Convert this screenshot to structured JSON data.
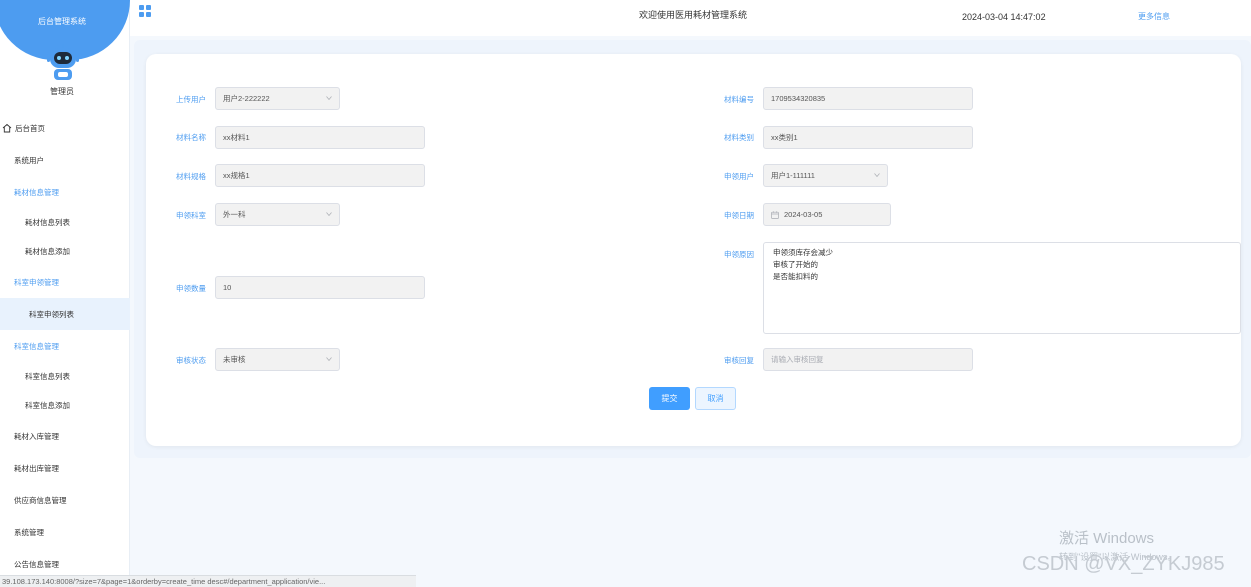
{
  "app": {
    "title": "后台管理系统",
    "role": "管理员"
  },
  "header": {
    "welcome": "欢迎使用医用耗材管理系统",
    "datetime": "2024-03-04 14:47:02",
    "more": "更多信息"
  },
  "menu": [
    {
      "label": "后台首页",
      "kind": "first"
    },
    {
      "label": "系统用户",
      "kind": "top"
    },
    {
      "label": "耗材信息管理",
      "kind": "group"
    },
    {
      "label": "耗材信息列表",
      "kind": "sub"
    },
    {
      "label": "耗材信息添加",
      "kind": "sub"
    },
    {
      "label": "科室申领管理",
      "kind": "group"
    },
    {
      "label": "科室申领列表",
      "kind": "active"
    },
    {
      "label": "科室信息管理",
      "kind": "group"
    },
    {
      "label": "科室信息列表",
      "kind": "sub"
    },
    {
      "label": "科室信息添加",
      "kind": "sub"
    },
    {
      "label": "耗材入库管理",
      "kind": "top"
    },
    {
      "label": "耗材出库管理",
      "kind": "top"
    },
    {
      "label": "供应商信息管理",
      "kind": "top"
    },
    {
      "label": "系统管理",
      "kind": "top"
    },
    {
      "label": "公告信息管理",
      "kind": "top"
    }
  ],
  "form": {
    "upload_user": {
      "label": "上传用户",
      "value": "用户2-222222"
    },
    "material_no": {
      "label": "材料编号",
      "value": "1709534320835"
    },
    "material_name": {
      "label": "材料名称",
      "value": "xx材料1"
    },
    "material_category": {
      "label": "材料类别",
      "value": "xx类别1"
    },
    "material_spec": {
      "label": "材料规格",
      "value": "xx规格1"
    },
    "apply_user": {
      "label": "申领用户",
      "value": "用户1-111111"
    },
    "apply_dept": {
      "label": "申领科室",
      "value": "外一科"
    },
    "apply_date": {
      "label": "申领日期",
      "value": "2024-03-05"
    },
    "apply_reason": {
      "label": "申领原因",
      "value": "申领须库存会减少\n审核了开始的\n是否能扣料的"
    },
    "apply_qty": {
      "label": "申领数量",
      "value": "10"
    },
    "review_status": {
      "label": "审核状态",
      "value": "未审核"
    },
    "review_reply": {
      "label": "审核回复",
      "placeholder": "请输入审核回复"
    },
    "submit_label": "提交",
    "cancel_label": "取消"
  },
  "watermark": {
    "windows_title": "激活 Windows",
    "windows_sub": "转到\"设置\"以激活 Windows。",
    "csdn": "CSDN @VX_ZYKJ985"
  },
  "status_url": "39.108.173.140:8008/?size=7&page=1&orderby=create_time desc#/department_application/vie..."
}
